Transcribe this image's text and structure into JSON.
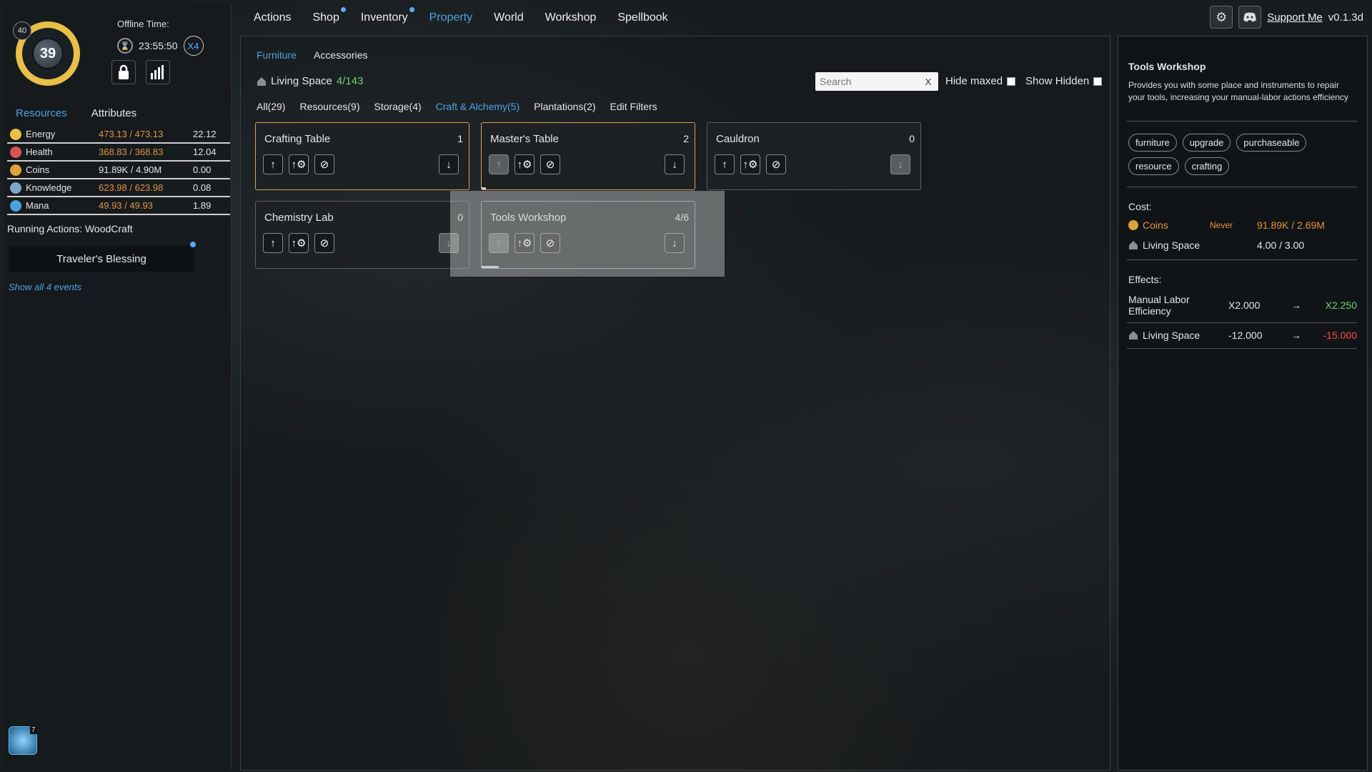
{
  "player": {
    "level_badge": "40",
    "level": "39",
    "offline_label": "Offline Time:",
    "offline_time": "23:55:50",
    "speed": "X4"
  },
  "left_tabs": [
    "Resources",
    "Attributes"
  ],
  "resources": [
    {
      "name": "Energy",
      "value": "473.13 / 473.13",
      "rate": "22.12",
      "value_color": "#e3943c",
      "icon_color": "#e8bf47"
    },
    {
      "name": "Health",
      "value": "368.83 / 368.83",
      "rate": "12.04",
      "value_color": "#e3943c",
      "icon_color": "#d9534f"
    },
    {
      "name": "Coins",
      "value": "91.89K / 4.90M",
      "rate": "0.00",
      "value_color": "#e6e6e6",
      "icon_color": "#d9a43a"
    },
    {
      "name": "Knowledge",
      "value": "623.98 / 623.98",
      "rate": "0.08",
      "value_color": "#e3943c",
      "icon_color": "#7aa7c7"
    },
    {
      "name": "Mana",
      "value": "49.93 / 49.93",
      "rate": "1.89",
      "value_color": "#e3943c",
      "icon_color": "#4aa3df"
    }
  ],
  "running_actions": "Running Actions: WoodCraft",
  "blessing": "Traveler's Blessing",
  "show_events": "Show all 4 events",
  "gem_count": "7",
  "nav": {
    "items": [
      "Actions",
      "Shop",
      "Inventory",
      "Property",
      "World",
      "Workshop",
      "Spellbook"
    ],
    "active": "Property",
    "support": "Support Me",
    "version": "v0.1.3d"
  },
  "property": {
    "sub_tabs": [
      "Furniture",
      "Accessories"
    ],
    "living_label": "Living Space",
    "living_value": "4/143",
    "search_placeholder": "Search",
    "search_clear": "X",
    "hide_maxed": "Hide maxed",
    "show_hidden": "Show Hidden",
    "categories": [
      "All(29)",
      "Resources(9)",
      "Storage(4)",
      "Craft & Alchemy(5)",
      "Plantations(2)",
      "Edit Filters"
    ],
    "active_category": "Craft & Alchemy(5)",
    "cards": [
      {
        "name": "Crafting Table",
        "count": "1",
        "progress": 0.0
      },
      {
        "name": "Master's Table",
        "count": "2",
        "progress": 0.02
      },
      {
        "name": "Cauldron",
        "count": "0",
        "progress": 0.0
      },
      {
        "name": "Chemistry Lab",
        "count": "0",
        "progress": 0.0
      },
      {
        "name": "Tools Workshop",
        "count": "4/6",
        "progress": 0.08
      }
    ]
  },
  "detail": {
    "title": "Tools Workshop",
    "description": "Provides you with some place and instruments to repair your tools, increasing your manual-labor actions efficiency",
    "tags": [
      "furniture",
      "upgrade",
      "purchaseable",
      "resource",
      "crafting"
    ],
    "cost_label": "Cost:",
    "costs": [
      {
        "name": "Coins",
        "never": "Never",
        "value": "91.89K / 2.69M"
      },
      {
        "name": "Living Space",
        "never": "",
        "value": "4.00 / 3.00"
      }
    ],
    "effects_label": "Effects:",
    "effects": [
      {
        "name": "Manual Labor Efficiency",
        "from": "X2.000",
        "arrow": "→",
        "to": "X2.250"
      },
      {
        "name": "Living Space",
        "from": "-12.000",
        "arrow": "→",
        "to": "-15.000"
      }
    ]
  }
}
